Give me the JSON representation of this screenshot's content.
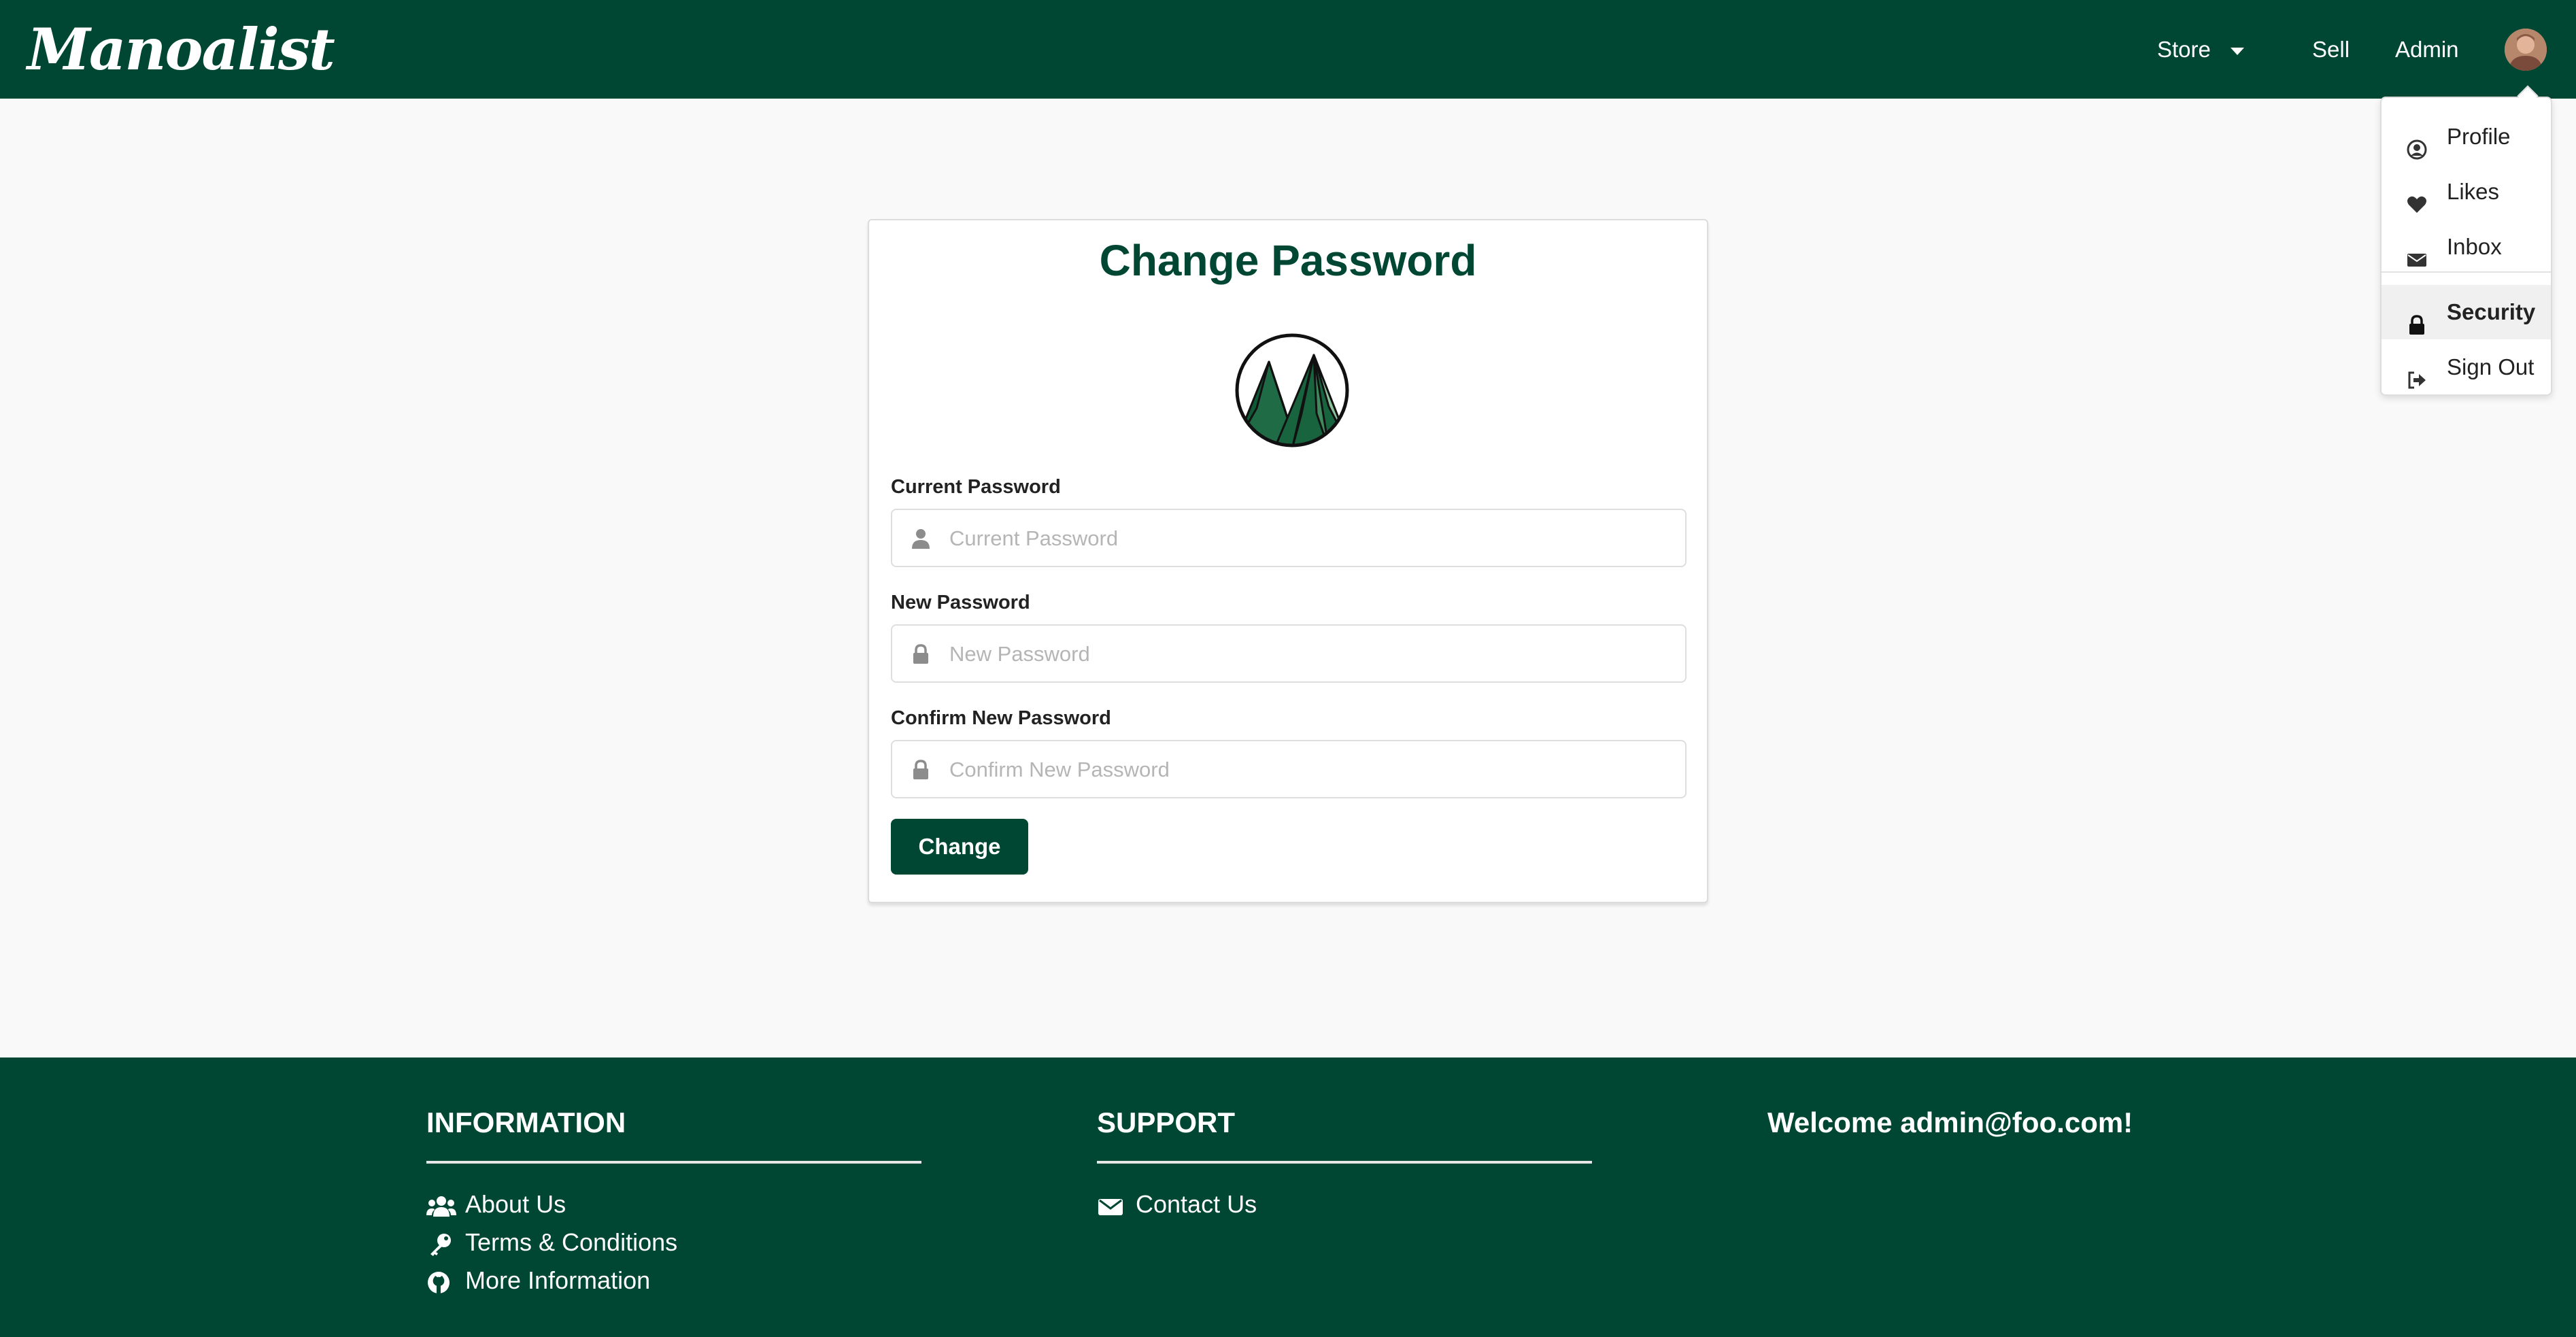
{
  "header": {
    "brand": "Manoalist",
    "nav": {
      "store": "Store",
      "sell": "Sell",
      "admin": "Admin"
    }
  },
  "user_menu": {
    "items": [
      {
        "label": "Profile",
        "icon": "user-circle-icon"
      },
      {
        "label": "Likes",
        "icon": "heart-icon"
      },
      {
        "label": "Inbox",
        "icon": "envelope-icon"
      },
      {
        "label": "Security",
        "icon": "lock-icon",
        "active": true
      },
      {
        "label": "Sign Out",
        "icon": "sign-out-icon"
      }
    ]
  },
  "form": {
    "title": "Change Password",
    "current": {
      "label": "Current Password",
      "placeholder": "Current Password",
      "value": ""
    },
    "new": {
      "label": "New Password",
      "placeholder": "New Password",
      "value": ""
    },
    "confirm": {
      "label": "Confirm New Password",
      "placeholder": "Confirm New Password",
      "value": ""
    },
    "submit_label": "Change"
  },
  "footer": {
    "information": {
      "heading": "INFORMATION",
      "links": [
        {
          "label": "About Us",
          "icon": "users-icon"
        },
        {
          "label": "Terms & Conditions",
          "icon": "key-icon"
        },
        {
          "label": "More Information",
          "icon": "github-icon"
        }
      ]
    },
    "support": {
      "heading": "SUPPORT",
      "links": [
        {
          "label": "Contact Us",
          "icon": "envelope-icon"
        }
      ]
    },
    "welcome": "Welcome admin@foo.com!"
  },
  "colors": {
    "brand_green": "#004733",
    "page_bg": "#f9f9f9"
  }
}
